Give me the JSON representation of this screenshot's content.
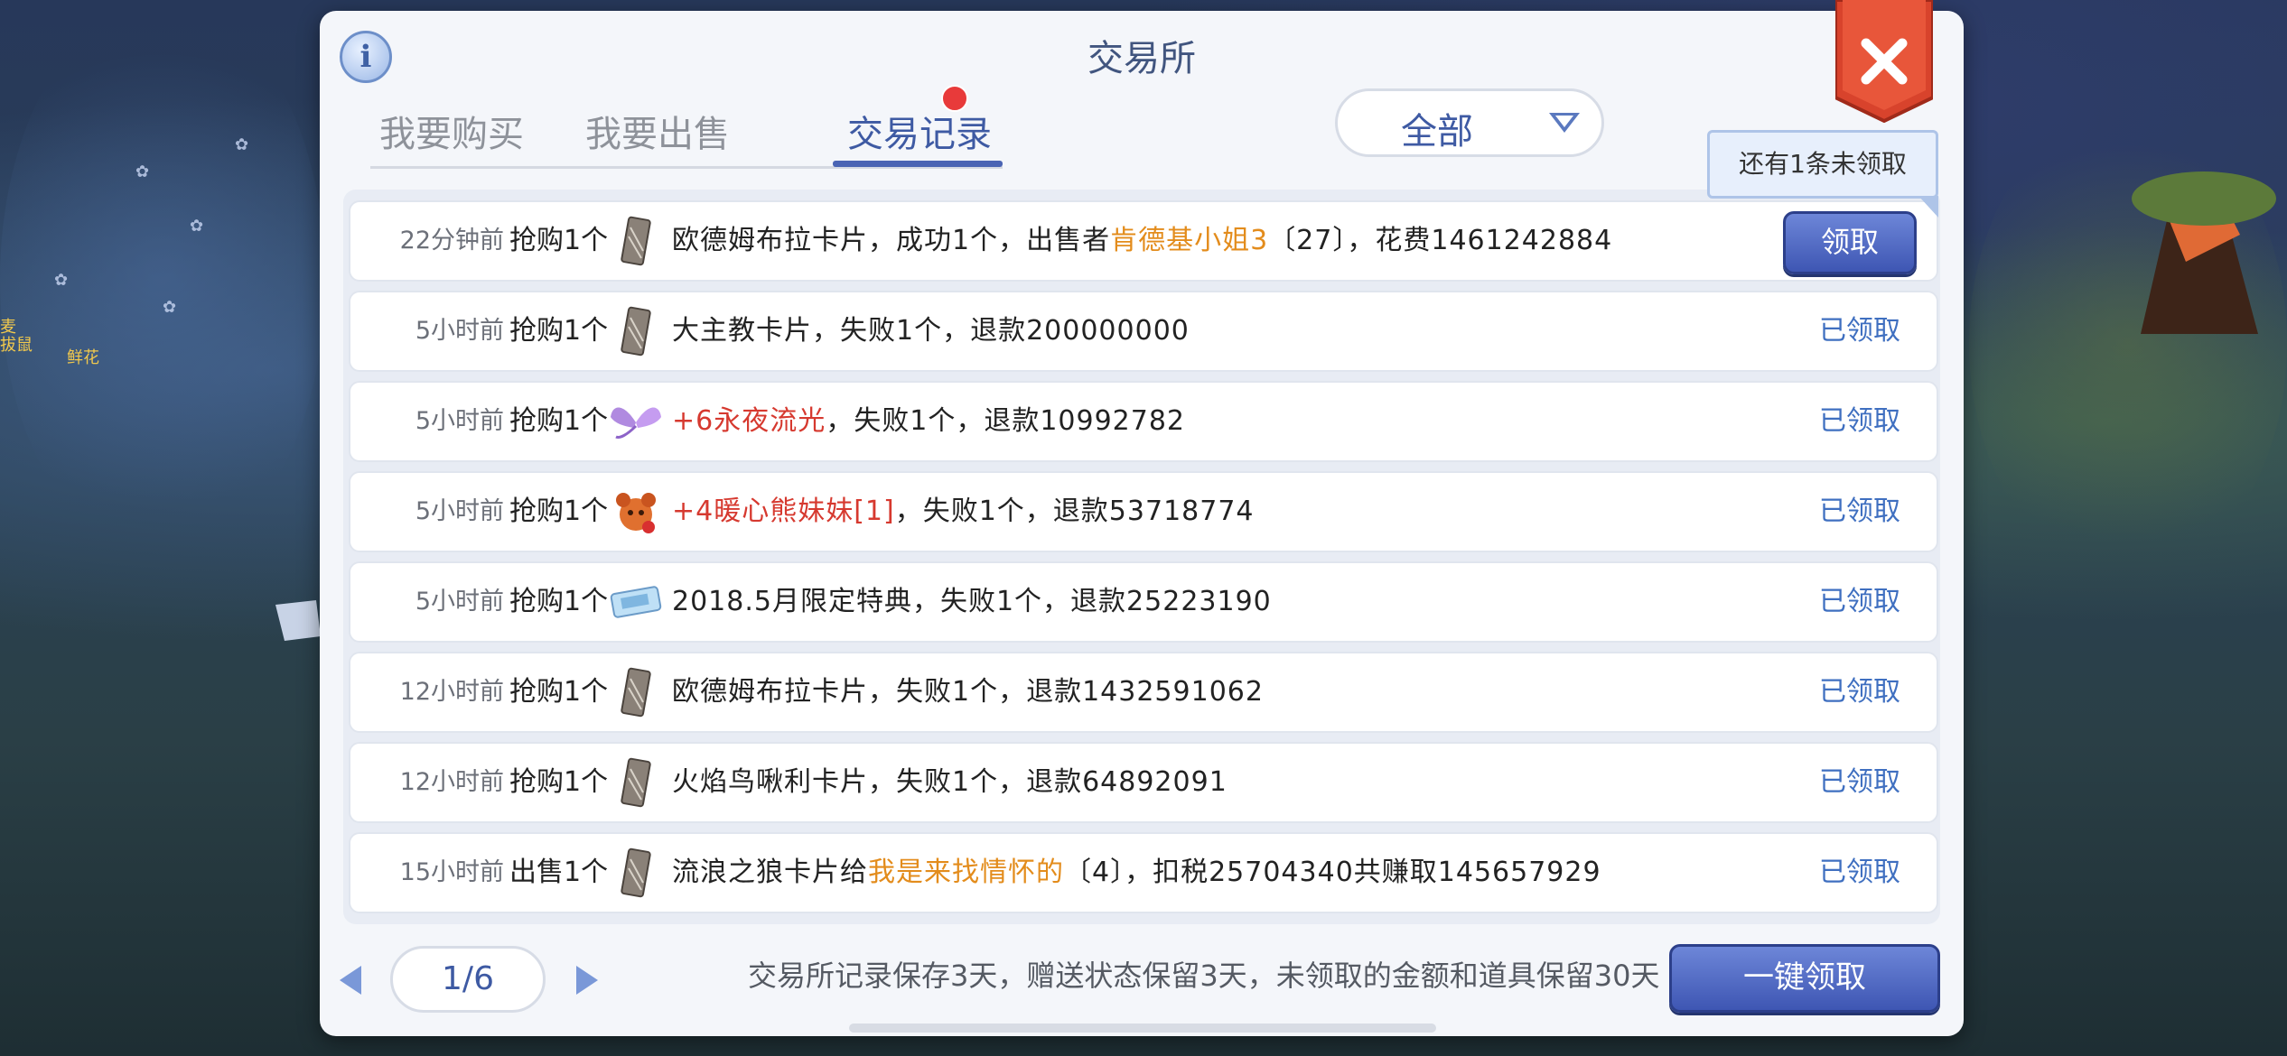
{
  "background": {
    "labels": [
      "麦",
      "拔鼠",
      "鲜花"
    ]
  },
  "panel": {
    "title": "交易所",
    "tabs": [
      {
        "label": "我要购买",
        "active": false
      },
      {
        "label": "我要出售",
        "active": false
      },
      {
        "label": "交易记录",
        "active": true
      }
    ],
    "filter": {
      "selected": "全部"
    },
    "tooltip": "还有1条未领取",
    "rows": [
      {
        "time": "22分钟前",
        "action": "抢购1个",
        "icon": "card-icon",
        "desc": [
          {
            "t": "欧德姆布拉卡片，成功1个，出售者"
          },
          {
            "t": "肯德基小姐3",
            "c": "orange"
          },
          {
            "t": "〔27〕，花费1461242884"
          }
        ],
        "status": "领取",
        "claimable": true
      },
      {
        "time": "5小时前",
        "action": "抢购1个",
        "icon": "card-icon",
        "desc": [
          {
            "t": "大主教卡片，失败1个，退款200000000"
          }
        ],
        "status": "已领取",
        "claimable": false
      },
      {
        "time": "5小时前",
        "action": "抢购1个",
        "icon": "wings-icon",
        "desc": [
          {
            "t": "+6永夜流光",
            "c": "red"
          },
          {
            "t": "，失败1个，退款10992782"
          }
        ],
        "status": "已领取",
        "claimable": false
      },
      {
        "time": "5小时前",
        "action": "抢购1个",
        "icon": "bear-icon",
        "desc": [
          {
            "t": "+4暖心熊妹妹[1]",
            "c": "red"
          },
          {
            "t": "，失败1个，退款53718774"
          }
        ],
        "status": "已领取",
        "claimable": false
      },
      {
        "time": "5小时前",
        "action": "抢购1个",
        "icon": "ticket-icon",
        "desc": [
          {
            "t": "2018.5月限定特典，失败1个，退款25223190"
          }
        ],
        "status": "已领取",
        "claimable": false
      },
      {
        "time": "12小时前",
        "action": "抢购1个",
        "icon": "card-icon",
        "desc": [
          {
            "t": "欧德姆布拉卡片，失败1个，退款1432591062"
          }
        ],
        "status": "已领取",
        "claimable": false
      },
      {
        "time": "12小时前",
        "action": "抢购1个",
        "icon": "card-icon",
        "desc": [
          {
            "t": "火焰鸟啾利卡片，失败1个，退款64892091"
          }
        ],
        "status": "已领取",
        "claimable": false
      },
      {
        "time": "15小时前",
        "action": "出售1个",
        "icon": "card-icon",
        "desc": [
          {
            "t": "流浪之狼卡片给"
          },
          {
            "t": "我是来找情怀的",
            "c": "orange"
          },
          {
            "t": "〔4〕，扣税25704340共赚取145657929"
          }
        ],
        "status": "已领取",
        "claimable": false
      }
    ],
    "pager": {
      "page": "1/6"
    },
    "notice": "交易所记录保存3天，赠送状态保留3天，未领取的金额和道具保留30天",
    "claim_all": "一键领取"
  },
  "colors": {
    "accent": "#3e5aa3",
    "orange": "#e38c1c",
    "red": "#d6392f",
    "close": "#e0452e"
  }
}
